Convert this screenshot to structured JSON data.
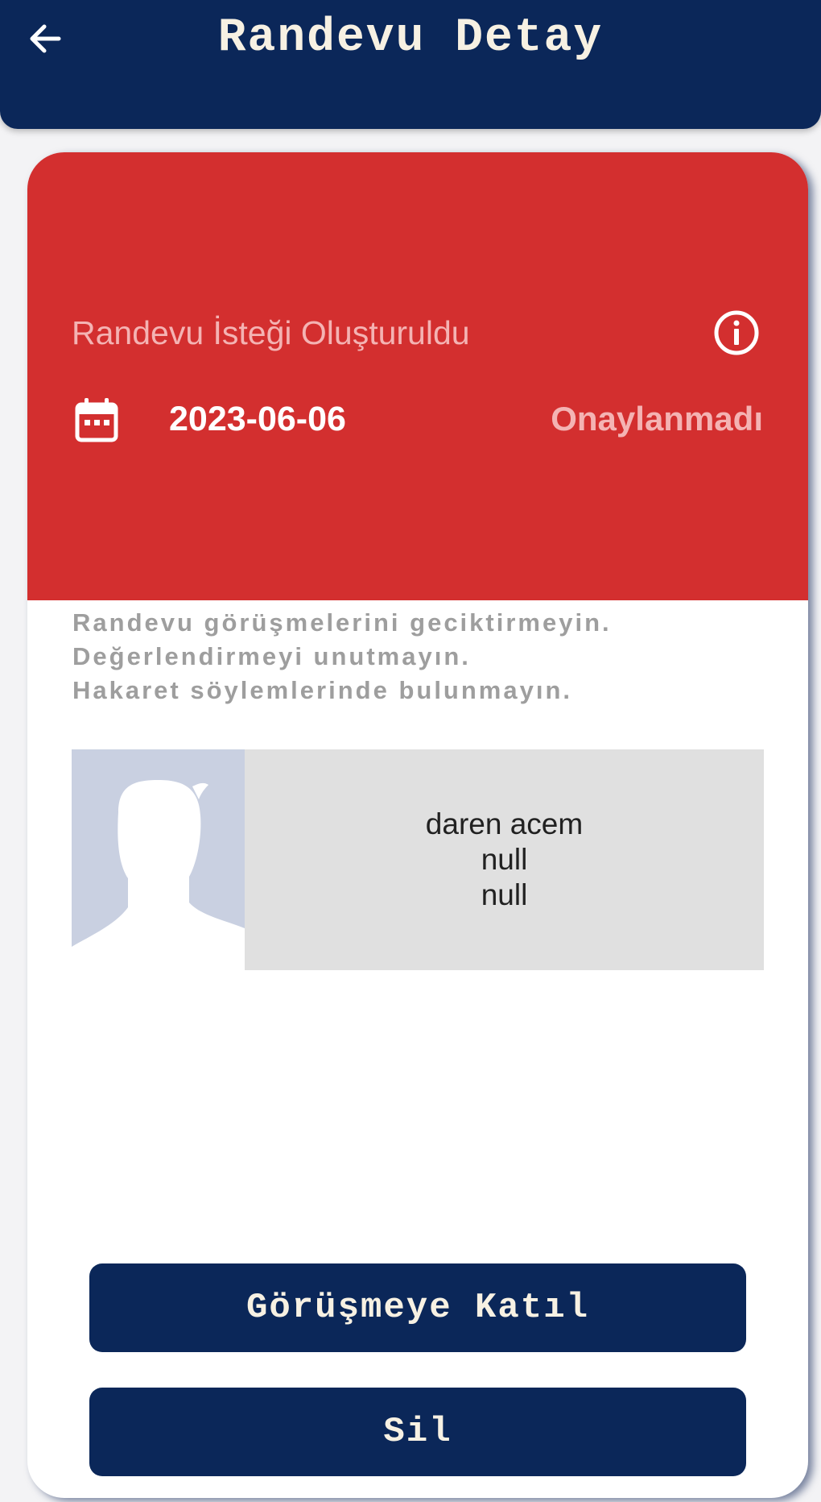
{
  "app_bar": {
    "title": "Randevu Detay",
    "back_icon": "arrow-left-icon",
    "background": "#0b2759"
  },
  "card": {
    "header": {
      "title": "Randevu İsteği Oluşturuldu",
      "info_icon": "info-circle-icon",
      "calendar_icon": "calendar-icon",
      "date": "2023-06-06",
      "status": "Onaylanmadı",
      "background": "#d32f2f"
    },
    "notes": [
      "Randevu görüşmelerini geciktirmeyin.",
      "Değerlendirmeyi unutmayın.",
      "Hakaret söylemlerinde bulunmayın."
    ],
    "profile": {
      "avatar_icon": "person-silhouette-icon",
      "lines": [
        "daren acem",
        "null",
        "null"
      ]
    },
    "buttons": {
      "join_label": "Görüşmeye Katıl",
      "delete_label": "Sil"
    }
  }
}
